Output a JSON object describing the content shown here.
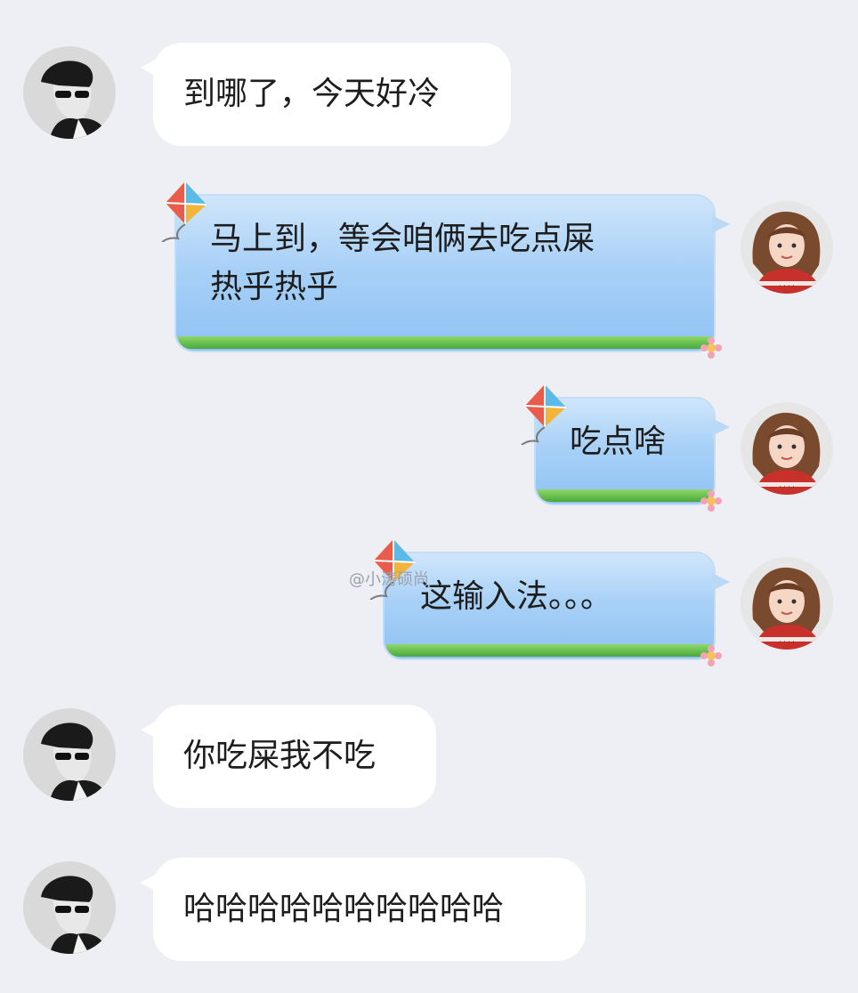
{
  "messages": [
    {
      "side": "left",
      "text": "到哪了，今天好冷"
    },
    {
      "side": "right",
      "lines": [
        "马上到，等会咱俩去吃点屎",
        "热乎热乎"
      ]
    },
    {
      "side": "right",
      "lines": [
        "吃点啥"
      ]
    },
    {
      "side": "right",
      "lines": [
        "这输入法。。。"
      ]
    },
    {
      "side": "left",
      "text": "你吃屎我不吃"
    },
    {
      "side": "left",
      "text": "哈哈哈哈哈哈哈哈哈哈"
    }
  ],
  "watermark": "@小涛硕尚",
  "colors": {
    "background": "#eeeff4",
    "bubble_in": "#ffffff",
    "bubble_out": "#a9d1f7",
    "grass": "#4aa83a"
  },
  "icons": {
    "left_avatar": "man-sunglasses-avatar",
    "right_avatar": "girl-avatar",
    "bubble_decoration": "kite-icon"
  }
}
